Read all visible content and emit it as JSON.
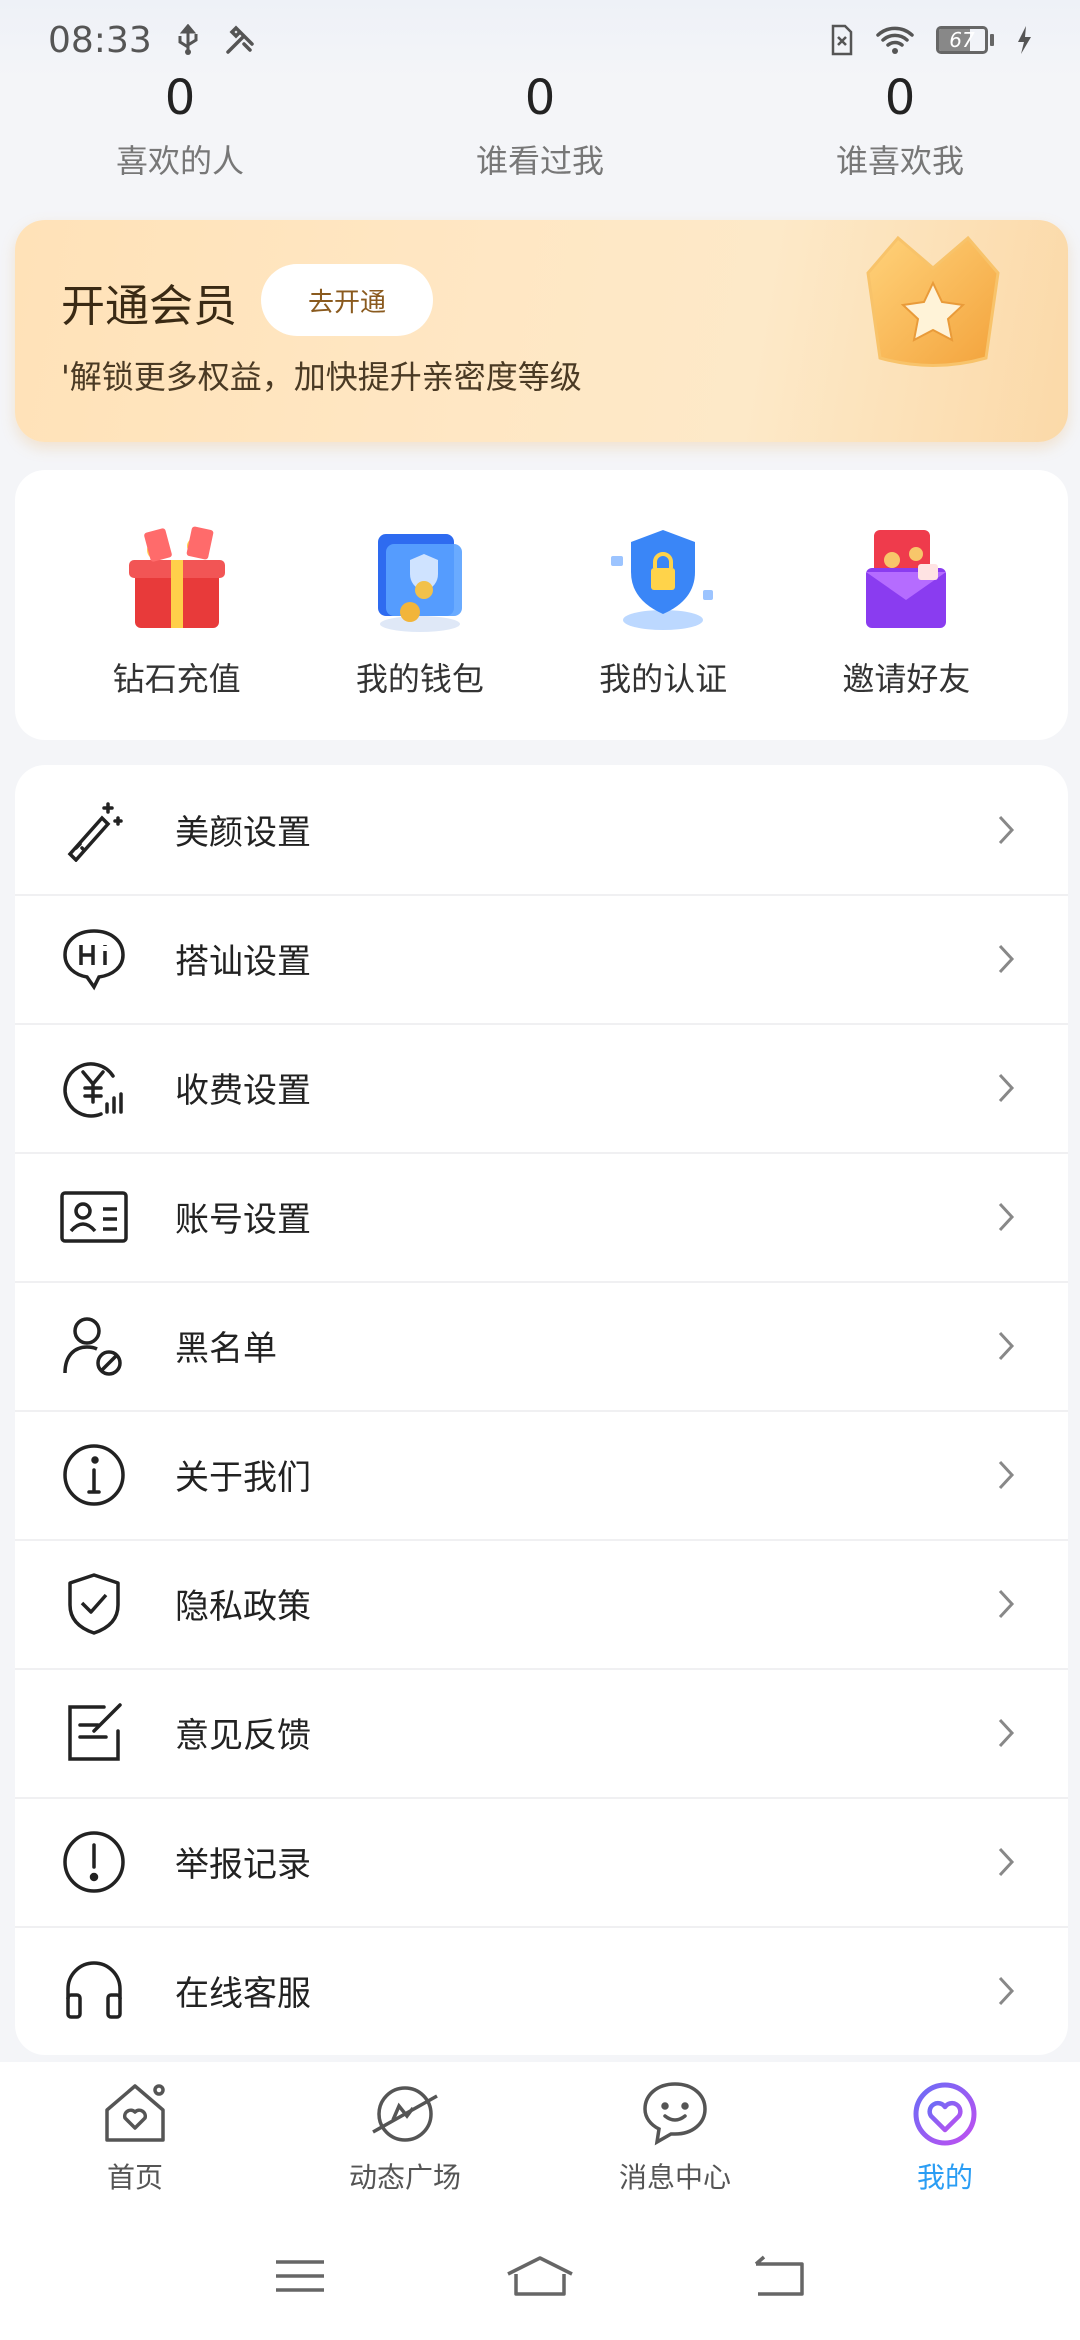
{
  "status_bar": {
    "time": "08:33",
    "battery_level": "67",
    "icons": [
      "usb-icon",
      "tools-icon",
      "sim-off-icon",
      "wifi-icon",
      "battery-icon",
      "charging-icon"
    ]
  },
  "stats": [
    {
      "value": "0",
      "label": "喜欢的人"
    },
    {
      "value": "0",
      "label": "谁看过我"
    },
    {
      "value": "0",
      "label": "谁喜欢我"
    }
  ],
  "vip": {
    "title": "开通会员",
    "button": "去开通",
    "description": "'解锁更多权益，加快提升亲密度等级"
  },
  "quick_actions": [
    {
      "label": "钻石充值",
      "icon": "gift-box-icon"
    },
    {
      "label": "我的钱包",
      "icon": "wallet-icon"
    },
    {
      "label": "我的认证",
      "icon": "shield-lock-icon"
    },
    {
      "label": "邀请好友",
      "icon": "invite-envelope-icon"
    }
  ],
  "menu": [
    {
      "label": "美颜设置",
      "icon": "magic-wand-icon"
    },
    {
      "label": "搭讪设置",
      "icon": "hi-bubble-icon"
    },
    {
      "label": "收费设置",
      "icon": "yuan-chart-icon"
    },
    {
      "label": "账号设置",
      "icon": "id-card-icon"
    },
    {
      "label": "黑名单",
      "icon": "user-block-icon"
    },
    {
      "label": "关于我们",
      "icon": "info-icon"
    },
    {
      "label": "隐私政策",
      "icon": "shield-check-icon"
    },
    {
      "label": "意见反馈",
      "icon": "feedback-edit-icon"
    },
    {
      "label": "举报记录",
      "icon": "alert-icon"
    },
    {
      "label": "在线客服",
      "icon": "headset-icon"
    }
  ],
  "bottom_nav": [
    {
      "label": "首页",
      "icon": "home-heart-icon",
      "active": false
    },
    {
      "label": "动态广场",
      "icon": "planet-icon",
      "active": false
    },
    {
      "label": "消息中心",
      "icon": "chat-smile-icon",
      "active": false
    },
    {
      "label": "我的",
      "icon": "heart-circle-icon",
      "active": true
    }
  ],
  "colors": {
    "accent": "#2a9df4",
    "vip_gradient_start": "#ffe2b8",
    "vip_gradient_end": "#fbd9a8",
    "background": "#f4f5f8"
  }
}
